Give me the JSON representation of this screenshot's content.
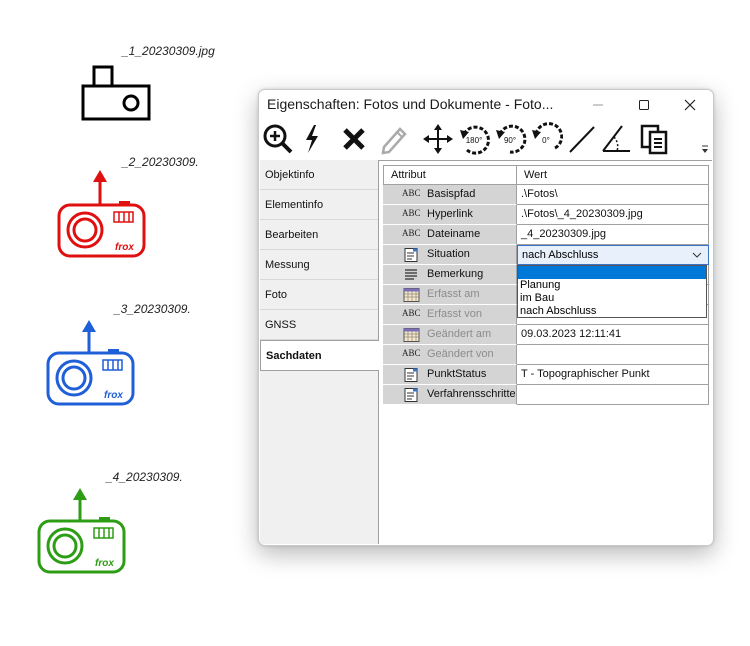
{
  "cameras": [
    {
      "label": "_1_20230309.jpg",
      "color": "#000000"
    },
    {
      "label": "_2_20230309.",
      "color": "#e01010",
      "brand": "frox"
    },
    {
      "label": "_3_20230309.",
      "color": "#1f5fd8",
      "brand": "frox"
    },
    {
      "label": "_4_20230309.",
      "color": "#2e9d16",
      "brand": "frox"
    }
  ],
  "window": {
    "title": "Eigenschaften: Fotos und Dokumente - Foto...",
    "controls": [
      "minimize-icon",
      "maximize-icon",
      "close-icon"
    ]
  },
  "toolbar": {
    "tools": [
      "zoom-in-icon",
      "lightning-icon",
      "delete-icon",
      "edit-pencil-icon",
      "move-icon",
      "rotate-180-icon",
      "rotate-90-icon",
      "rotate-0-icon",
      "line-icon",
      "angle-icon",
      "copy-icon"
    ],
    "rotate_labels": [
      "180°",
      "90°",
      "0°"
    ]
  },
  "tabs": [
    "Objektinfo",
    "Elementinfo",
    "Bearbeiten",
    "Messung",
    "Foto",
    "GNSS",
    "Sachdaten"
  ],
  "active_tab": "Sachdaten",
  "grid": {
    "header_attr": "Attribut",
    "header_value": "Wert",
    "abc_glyph": "ABC",
    "rows": [
      {
        "icon": "abc-text-icon",
        "name": "Basispfad",
        "value": ".\\Fotos\\",
        "disabled": false
      },
      {
        "icon": "abc-text-icon",
        "name": "Hyperlink",
        "value": ".\\Fotos\\_4_20230309.jpg",
        "disabled": false
      },
      {
        "icon": "abc-text-icon",
        "name": "Dateiname",
        "value": "_4_20230309.jpg",
        "disabled": false
      },
      {
        "icon": "list-doc-icon",
        "name": "Situation",
        "value": "nach Abschluss",
        "disabled": false
      },
      {
        "icon": "lines-icon",
        "name": "Bemerkung",
        "value": "",
        "disabled": false
      },
      {
        "icon": "calendar-icon",
        "name": "Erfasst am",
        "value": "",
        "disabled": true
      },
      {
        "icon": "abc-text-icon",
        "name": "Erfasst von",
        "value": "",
        "disabled": true
      },
      {
        "icon": "calendar-icon",
        "name": "Geändert am",
        "value": "09.03.2023 12:11:41",
        "disabled": true
      },
      {
        "icon": "abc-text-icon",
        "name": "Geändert von",
        "value": "",
        "disabled": true
      },
      {
        "icon": "list-doc-icon",
        "name": "PunktStatus",
        "value": "T - Topographischer Punkt",
        "disabled": false
      },
      {
        "icon": "list-doc-icon",
        "name": "Verfahrensschritte",
        "value": "",
        "disabled": false
      }
    ]
  },
  "situation_dropdown": {
    "selected": "nach Abschluss",
    "options": [
      "",
      "Planung",
      "im Bau",
      "nach Abschluss"
    ],
    "highlighted_index": 0
  }
}
